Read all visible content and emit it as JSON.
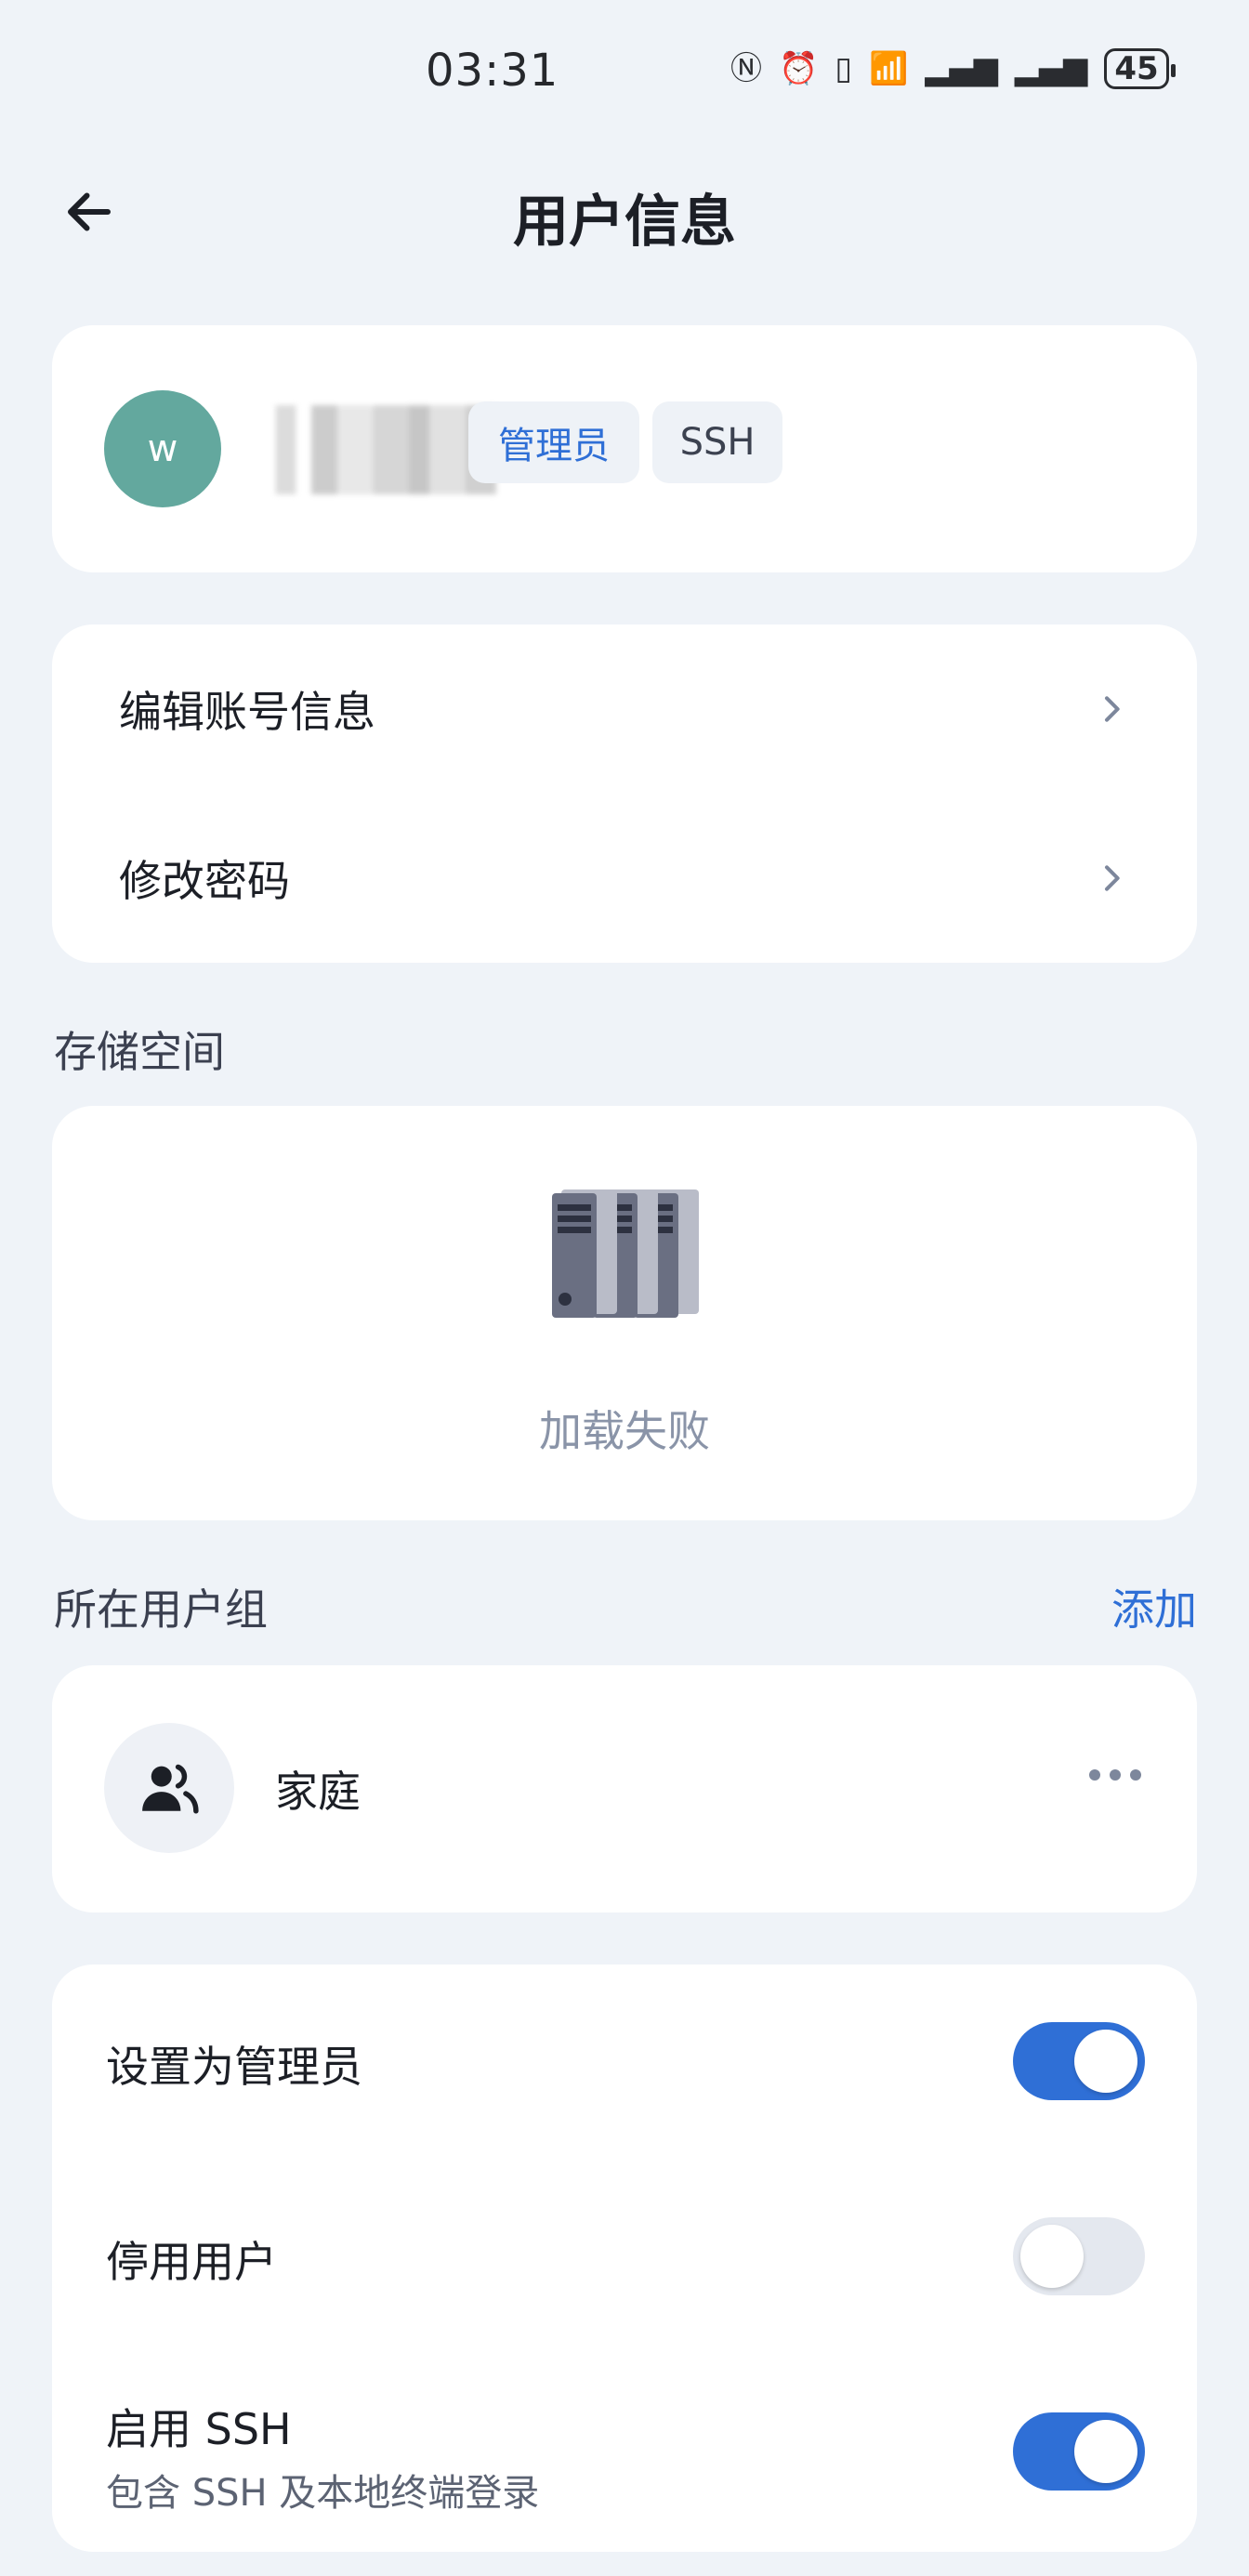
{
  "status_bar": {
    "time": "03:31",
    "icons": [
      "nfc-icon",
      "alarm-icon",
      "vibrate-icon",
      "wifi-icon",
      "signal-5g-icon",
      "signal-4g-icon"
    ],
    "battery": "45"
  },
  "header": {
    "title": "用户信息"
  },
  "profile": {
    "avatar_letter": "w",
    "badges": {
      "admin": "管理员",
      "ssh": "SSH"
    }
  },
  "menu": {
    "edit_account": "编辑账号信息",
    "change_password": "修改密码"
  },
  "storage": {
    "section_title": "存储空间",
    "status": "加载失败"
  },
  "groups": {
    "section_title": "所在用户组",
    "add_label": "添加",
    "items": [
      {
        "name": "家庭"
      }
    ]
  },
  "settings": {
    "set_admin": {
      "label": "设置为管理员",
      "enabled": true
    },
    "disable_user": {
      "label": "停用用户",
      "enabled": false
    },
    "enable_ssh": {
      "label": "启用 SSH",
      "sub": "包含 SSH 及本地终端登录",
      "enabled": true
    }
  },
  "colors": {
    "accent": "#2f6fd6",
    "avatar": "#63a89e",
    "background": "#eff3f8"
  }
}
